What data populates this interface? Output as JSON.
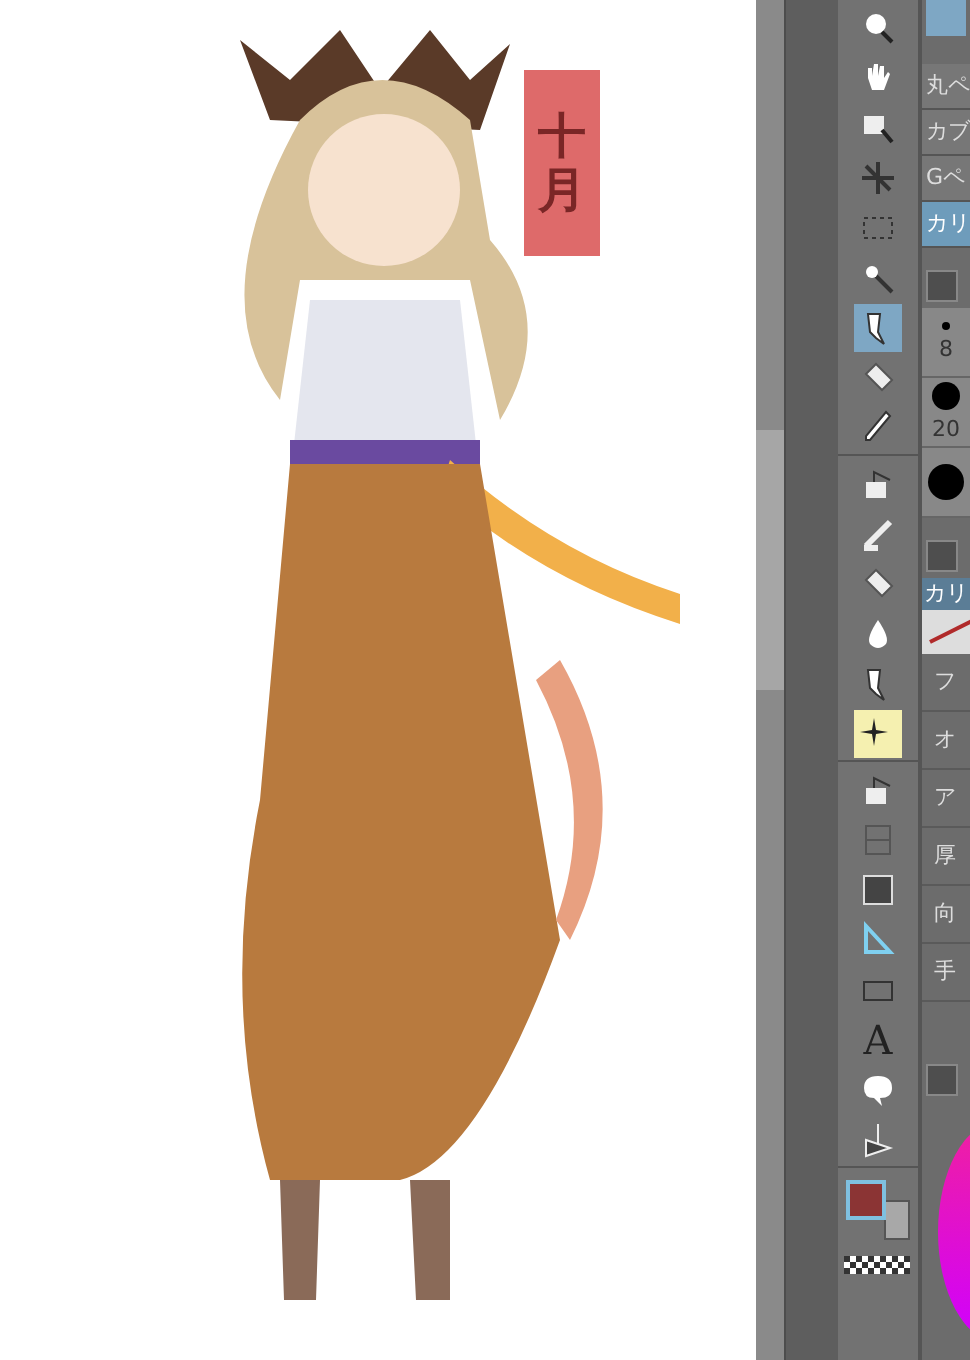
{
  "canvas": {
    "label": "十月"
  },
  "tool_groups": [
    {
      "tools": [
        {
          "kind": "zoom",
          "selected": false
        },
        {
          "kind": "hand",
          "selected": false
        },
        {
          "kind": "object",
          "selected": false
        },
        {
          "kind": "move",
          "selected": false
        },
        {
          "kind": "select",
          "selected": false
        },
        {
          "kind": "wand",
          "selected": false
        },
        {
          "kind": "pen",
          "selected": true
        },
        {
          "kind": "eraser",
          "selected": false
        },
        {
          "kind": "dropper",
          "selected": false
        }
      ]
    },
    {
      "tools": [
        {
          "kind": "bucket",
          "selected": false
        },
        {
          "kind": "blend",
          "selected": false
        },
        {
          "kind": "block",
          "selected": false
        },
        {
          "kind": "drop",
          "selected": false
        },
        {
          "kind": "nib",
          "selected": false
        },
        {
          "kind": "sparkle",
          "selected": true
        }
      ]
    },
    {
      "tools": [
        {
          "kind": "stamp",
          "selected": false
        },
        {
          "kind": "frame",
          "selected": false
        },
        {
          "kind": "gradient",
          "selected": false
        },
        {
          "kind": "ruler",
          "selected": false
        },
        {
          "kind": "rect",
          "selected": false
        },
        {
          "kind": "text",
          "selected": false,
          "glyph": "A"
        },
        {
          "kind": "balloon",
          "selected": false
        },
        {
          "kind": "line",
          "selected": false
        }
      ]
    }
  ],
  "subtools": [
    {
      "label": "丸ペ",
      "selected": false
    },
    {
      "label": "カブ",
      "selected": false
    },
    {
      "label": "Gペ",
      "selected": false
    },
    {
      "label": "カリ",
      "selected": true
    }
  ],
  "brush_sizes": [
    "8",
    "20"
  ],
  "tool_property": {
    "title": "カリ",
    "rows": [
      "フ",
      "オ",
      "ア",
      "厚",
      "向",
      "手"
    ]
  }
}
